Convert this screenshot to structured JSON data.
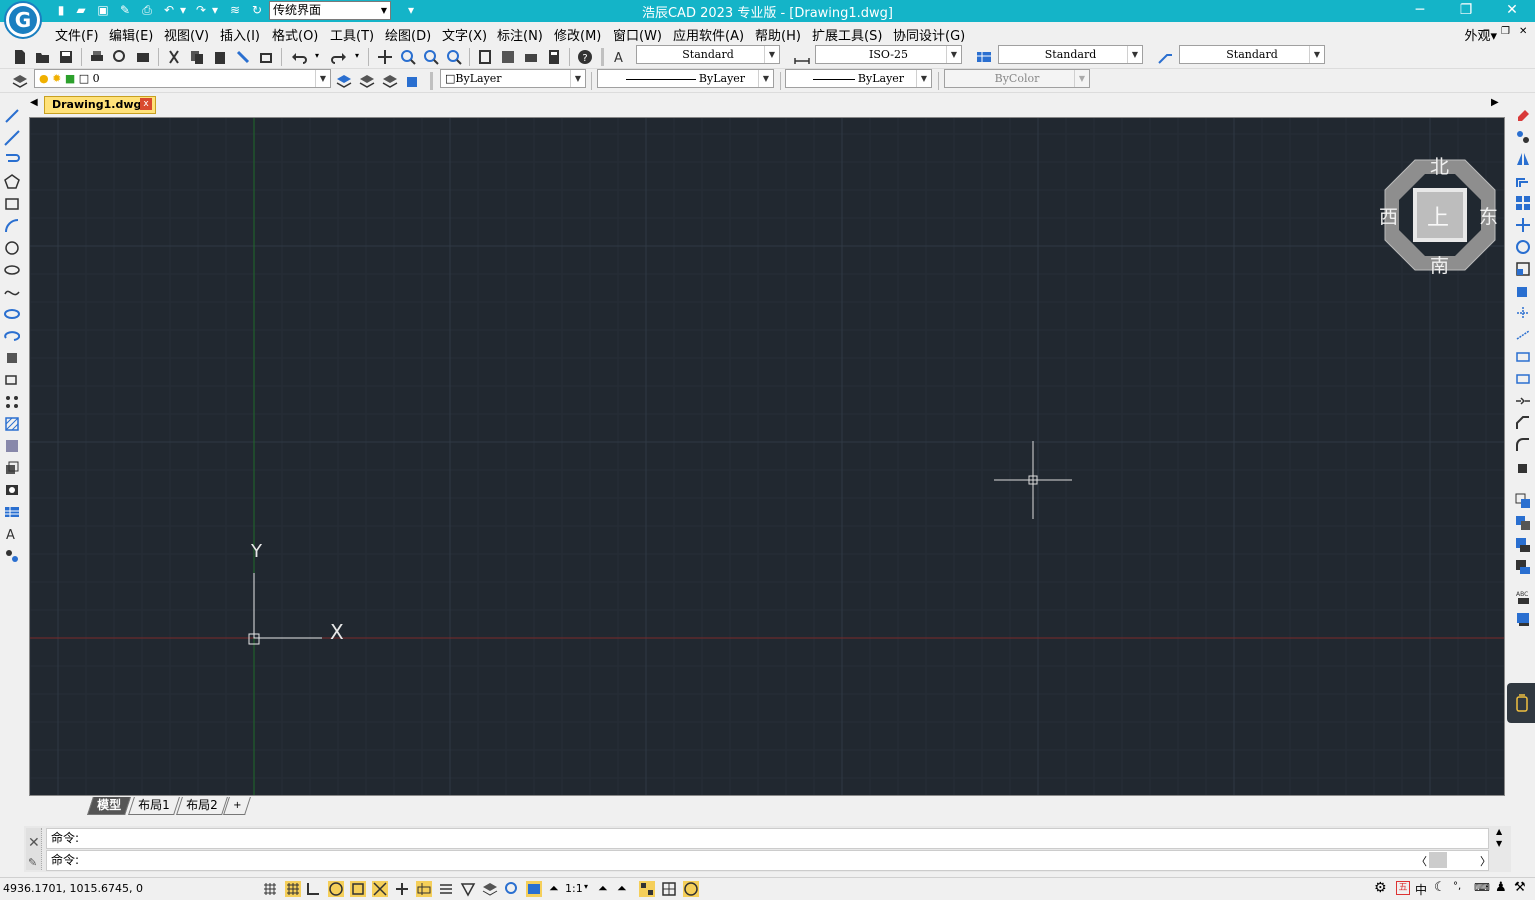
{
  "titlebar": {
    "workspace": "传统界面",
    "title": "浩辰CAD 2023 专业版 - [Drawing1.dwg]"
  },
  "menubar": {
    "items": [
      "文件(F)",
      "编辑(E)",
      "视图(V)",
      "插入(I)",
      "格式(O)",
      "工具(T)",
      "绘图(D)",
      "文字(X)",
      "标注(N)",
      "修改(M)",
      "窗口(W)",
      "应用软件(A)",
      "帮助(H)",
      "扩展工具(S)",
      "协同设计(G)"
    ],
    "appearance": "外观▾"
  },
  "toolbar1": {
    "text_style": "Standard",
    "dim_style": "ISO-25",
    "table_style": "Standard",
    "mleader_style": "Standard"
  },
  "toolbar2": {
    "layer": "0",
    "color": "ByLayer",
    "linetype": "ByLayer",
    "lineweight": "ByLayer",
    "plotstyle": "ByColor"
  },
  "tabs": {
    "doc": "Drawing1.dwg",
    "close": "x"
  },
  "viewcube": {
    "north": "北",
    "south": "南",
    "east": "东",
    "west": "西",
    "top": "上"
  },
  "ucs": {
    "x": "X",
    "y": "Y"
  },
  "layouts": {
    "model": "模型",
    "layout1": "布局1",
    "layout2": "布局2",
    "add": "+"
  },
  "command": {
    "line1": "命令:",
    "line2": "命令:"
  },
  "status": {
    "coords": "4936.1701, 1015.6745, 0",
    "scale": "1:1",
    "lang": "中"
  },
  "colors": {
    "title_bg": "#14b4c8",
    "canvas_bg": "#212830",
    "x_axis": "#7a2a2a",
    "y_axis": "#1f6a2a"
  }
}
